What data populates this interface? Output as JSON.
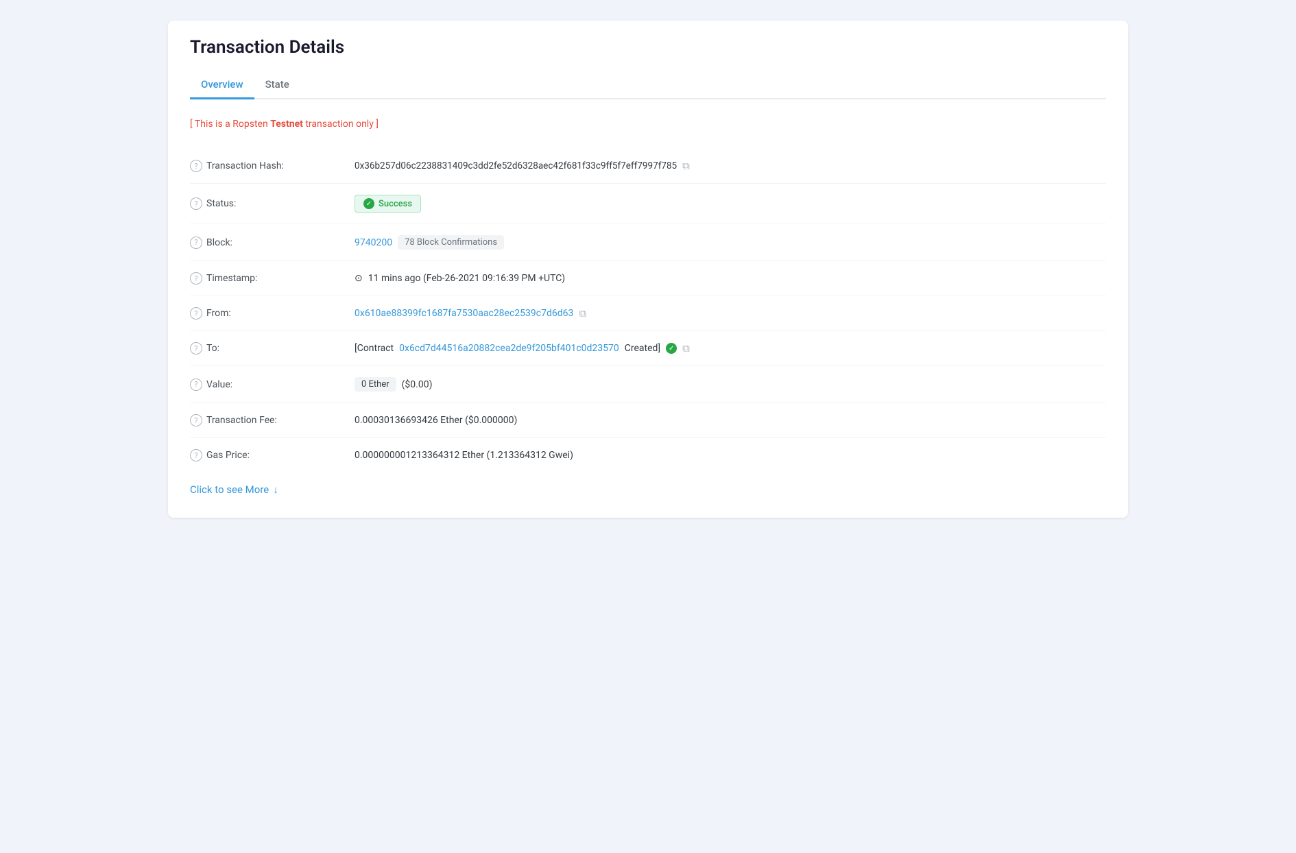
{
  "page": {
    "title": "Transaction Details"
  },
  "tabs": [
    {
      "id": "overview",
      "label": "Overview",
      "active": true
    },
    {
      "id": "state",
      "label": "State",
      "active": false
    }
  ],
  "testnet_banner": {
    "prefix": "[ This is a Ropsten ",
    "highlight": "Testnet",
    "suffix": " transaction only ]"
  },
  "rows": {
    "transaction_hash": {
      "label": "Transaction Hash:",
      "value": "0x36b257d06c2238831409c3dd2fe52d6328aec42f681f33c9ff5f7eff7997f785"
    },
    "status": {
      "label": "Status:",
      "value": "Success"
    },
    "block": {
      "label": "Block:",
      "number": "9740200",
      "confirmations": "78 Block Confirmations"
    },
    "timestamp": {
      "label": "Timestamp:",
      "value": "11 mins ago (Feb-26-2021 09:16:39 PM +UTC)"
    },
    "from": {
      "label": "From:",
      "value": "0x610ae88399fc1687fa7530aac28ec2539c7d6d63"
    },
    "to": {
      "label": "To:",
      "prefix": "[Contract ",
      "contract": "0x6cd7d44516a20882cea2de9f205bf401c0d23570",
      "suffix": " Created]"
    },
    "value": {
      "label": "Value:",
      "badge": "0 Ether",
      "usd": "($0.00)"
    },
    "transaction_fee": {
      "label": "Transaction Fee:",
      "value": "0.00030136693426 Ether ($0.000000)"
    },
    "gas_price": {
      "label": "Gas Price:",
      "value": "0.000000001213364312 Ether (1.213364312 Gwei)"
    }
  },
  "click_more": {
    "label": "Click to see More",
    "arrow": "↓"
  },
  "icons": {
    "help": "?",
    "copy": "⧉",
    "check": "✓",
    "clock": "⊙",
    "arrow_down": "↓"
  }
}
